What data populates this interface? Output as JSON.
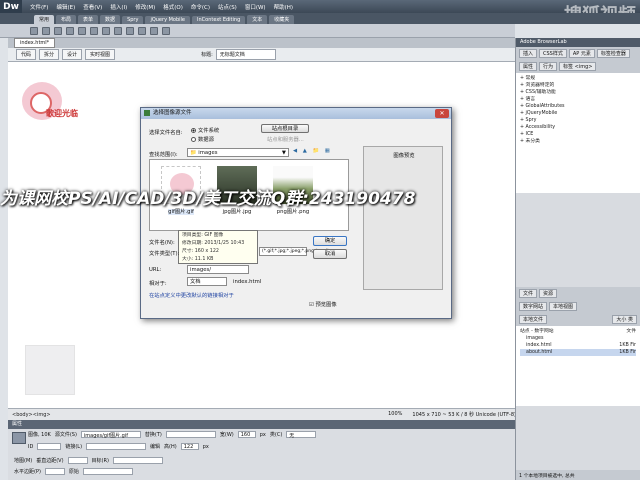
{
  "app": {
    "logo": "Dw",
    "menu": [
      "文件(F)",
      "编辑(E)",
      "查看(V)",
      "插入(I)",
      "修改(M)",
      "格式(O)",
      "命令(C)",
      "站点(S)",
      "窗口(W)",
      "帮助(H)"
    ],
    "watermark_top": "搜狐视频"
  },
  "insert_tabs": [
    "常用",
    "布局",
    "表单",
    "数据",
    "Spry",
    "jQuery Mobile",
    "InContext Editing",
    "文本",
    "收藏夹"
  ],
  "document": {
    "tab_label": "index.html*",
    "view_buttons": [
      "代码",
      "拆分",
      "设计",
      "实时视图"
    ],
    "title_label": "标题:",
    "title_value": "无标题文档"
  },
  "canvas": {
    "sticker_text": "歌迎光临"
  },
  "status": {
    "tag_selector": "<body><img>",
    "zoom": "100%",
    "info": "1045 x 710 ~ 53 K / 8 秒 Unicode (UTF-8)"
  },
  "properties": {
    "header": "属性",
    "image_label": "图像, 10K",
    "src_label": "源文件(S)",
    "src_value": "images/gif图片.gif",
    "link_label": "链接(L)",
    "alt_label": "替换(T)",
    "w_label": "宽(W)",
    "w_value": "160",
    "h_label": "高(H)",
    "h_value": "122",
    "px": "px",
    "edit_label": "编辑",
    "class_label": "类(C)",
    "class_value": "无",
    "id_label": "ID",
    "map_label": "地图(M)",
    "vspace_label": "垂直边距(V)",
    "target_label": "目标(R)",
    "hspace_label": "水平边距(P)",
    "lowsrc_label": "原始"
  },
  "right_panel": {
    "header": "Adobe BrowserLab",
    "tabs": [
      "插入",
      "CSS样式",
      "AP 元素",
      "标签检查器"
    ],
    "subtabs": [
      "属性",
      "行为",
      "标签 <img>"
    ],
    "tree": [
      "+ 常规",
      "+ 浏览器特定的",
      "+ CSS/辅助功能",
      "+ 语言",
      "+ GlobalAttributes",
      "+ jQueryMobile",
      "+ Spry",
      "+ Accessibility",
      "+ ICE",
      "+ 未分类"
    ],
    "files_tabs": [
      "文件",
      "资源"
    ],
    "site_select": "数字网站",
    "view_select": "本地视图",
    "files_header_left": "本地文件",
    "files_header_right": "大小 类",
    "files": [
      "站点 - 数字网站",
      "images",
      "index.html",
      "about.html"
    ],
    "files_sizes": [
      "",
      "文件",
      "1KB Fir",
      "1KB Fir"
    ],
    "files_status": "1 个本地项目被选中, 总共"
  },
  "dialog": {
    "title": "选择图像源文件",
    "select_from_label": "选择文件名自:",
    "radio_fs": "文件系统",
    "radio_ds": "数据源",
    "site_root_btn": "站点根目录",
    "server_btn": "站点和服务器...",
    "lookin_label": "查找范围(I):",
    "lookin_value": "images",
    "files": [
      "gif图片.gif",
      "jpg图片.jpg",
      "png图片.png"
    ],
    "filename_label": "文件名(N):",
    "filetype_label": "文件类型(T):",
    "filetype_value": "(*.gif;*.jpg;*.jpeg;*.png;*.psd)",
    "ok_btn": "确定",
    "cancel_btn": "取消",
    "url_label": "URL:",
    "url_value": "images/",
    "relative_label": "相对于:",
    "relative_value": "文档",
    "relative_file": "index.html",
    "default_link": "在站点定义中更改默认的链接相对于",
    "preview_label": "图像预览",
    "preview_checkbox": "预览图像",
    "tooltip": [
      "项目类型: GIF 图像",
      "修改日期: 2013/1/25 10:43",
      "尺寸: 160 x 122",
      "大小: 11.1 KB"
    ]
  },
  "overlay_text": "为课网校PS/AI/CAD/3D/美工交流Q群:243190478"
}
